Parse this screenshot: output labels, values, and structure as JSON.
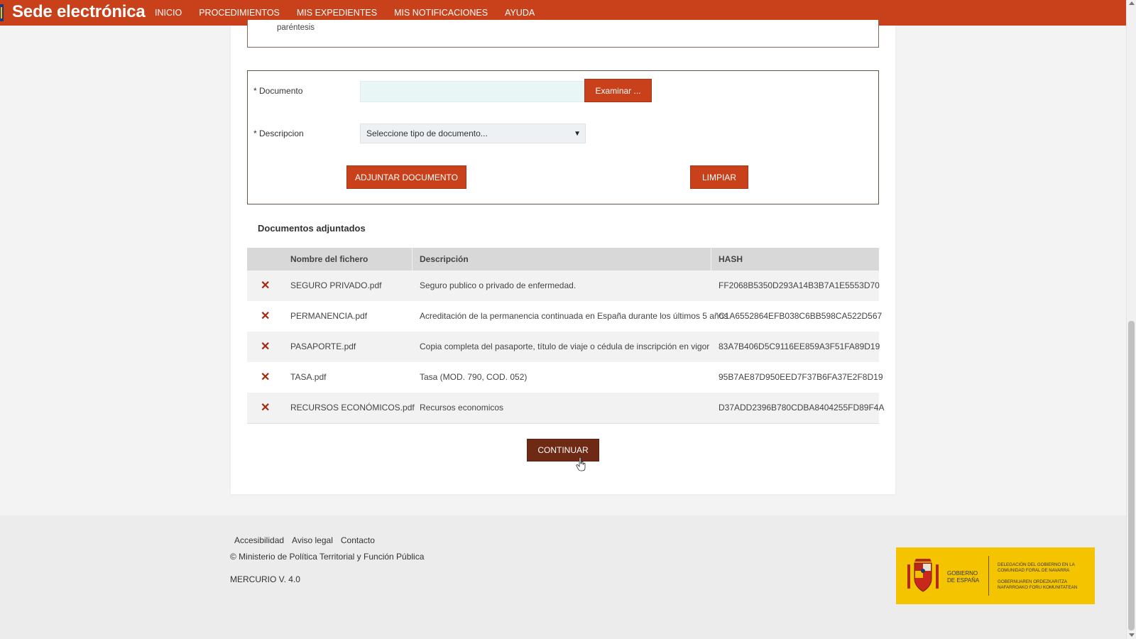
{
  "header": {
    "brand": "Sede electrónica",
    "nav": [
      "INICIO",
      "PROCEDIMIENTOS",
      "MIS EXPEDIENTES",
      "MIS NOTIFICACIONES",
      "AYUDA"
    ]
  },
  "top_box": {
    "text": "paréntesis"
  },
  "form": {
    "document_label": "* Documento",
    "browse_button": "Examinar ...",
    "description_label": "* Descripcion",
    "description_select": "Seleccione tipo de documento...",
    "attach_button": "ADJUNTAR DOCUMENTO",
    "clear_button": "LIMPIAR"
  },
  "attached": {
    "title": "Documentos adjuntados",
    "columns": [
      "Nombre del fichero",
      "Descripción",
      "HASH"
    ],
    "rows": [
      {
        "file": "SEGURO PRIVADO.pdf",
        "description": "Seguro publico o privado de enfermedad.",
        "hash": "FF2068B5350D293A14B3B7A1E5553D70"
      },
      {
        "file": "PERMANENCIA.pdf",
        "description": "Acreditación de la permanencia continuada en España durante los últimos 5 años",
        "hash": "C1A6552864EFB038C6BB598CA522D567"
      },
      {
        "file": "PASAPORTE.pdf",
        "description": "Copia completa del pasaporte, título de viaje o cédula de inscripción en vigor",
        "hash": "83A7B406D5C9116EE859A3F51FA89D19"
      },
      {
        "file": "TASA.pdf",
        "description": "Tasa (MOD. 790, COD. 052)",
        "hash": "95B7AE87D950EED7F37B6FA37E2F8D19"
      },
      {
        "file": "RECURSOS ECONÓMICOS.pdf",
        "description": "Recursos economicos",
        "hash": "D37ADD2396B780CDBA8404255FD89F4A"
      }
    ],
    "remove_glyph": "✕"
  },
  "continue_button": "CONTINUAR",
  "footer": {
    "links": [
      "Accesibilidad",
      "Aviso legal",
      "Contacto"
    ],
    "copyright": "© Ministerio de Política Territorial y Función Pública",
    "version": "MERCURIO V. 4.0",
    "logo": {
      "left_1": "GOBIERNO",
      "left_2": "DE ESPAÑA",
      "right_1": "DELEGACIÓN DEL GOBIERNO EN LA COMUNIDAD FORAL DE NAVARRA",
      "right_2": "GOBERNUAREN ORDEZKARITZA NAFARROAKO FORU KOMUNITATEAN"
    }
  },
  "colors": {
    "brand": "#c8411b",
    "continue": "#6e2a14",
    "logo_bg": "#f5c400"
  }
}
